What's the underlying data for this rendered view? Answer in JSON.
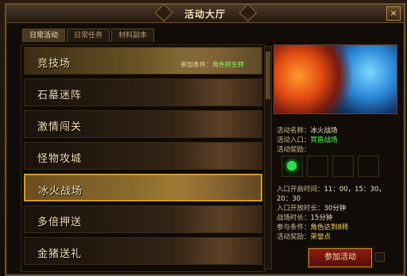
{
  "window": {
    "title": "活动大厅",
    "close_label": "×"
  },
  "tabs": [
    {
      "label": "日常活动",
      "active": true
    },
    {
      "label": "日常任务",
      "active": false
    },
    {
      "label": "材料副本",
      "active": false
    }
  ],
  "rows": [
    {
      "name": "竞技场",
      "time": "",
      "cond_label": "参加条件：",
      "cond_value": "角色转生转",
      "selected": false
    },
    {
      "name": "石墓迷阵",
      "time": "",
      "cond_label": "",
      "cond_value": "",
      "selected": false
    },
    {
      "name": "激情闯关",
      "time": "",
      "cond_label": "",
      "cond_value": "",
      "selected": false
    },
    {
      "name": "怪物攻城",
      "time": "",
      "cond_label": "",
      "cond_value": "",
      "selected": false
    },
    {
      "name": "冰火战场",
      "time": "",
      "cond_label": "",
      "cond_value": "",
      "selected": true
    },
    {
      "name": "多倍押送",
      "time": "",
      "cond_label": "",
      "cond_value": "",
      "selected": false
    },
    {
      "name": "金猪送礼",
      "time": "",
      "cond_label": "",
      "cond_value": "",
      "selected": false
    }
  ],
  "details": {
    "name_label": "活动名称：",
    "name_value": "冰火战场",
    "entry_label": "活动入口：",
    "entry_value": "冥盾战场",
    "reward_label": "活动奖励：",
    "open_time_label": "入口开启时间：",
    "open_time_value": "11：00，15：30，20：30",
    "open_duration_label": "入口开放时长：",
    "open_duration_value": "30分钟",
    "battle_duration_label": "战场时长：",
    "battle_duration_value": "15分钟",
    "condition_label": "参与条件：",
    "condition_value": "角色达到8转",
    "rewards_label": "活动奖励：",
    "rewards_value": "荣誉点"
  },
  "button": {
    "label": "参加活动"
  },
  "icons": {
    "close": "close-icon",
    "reward": "gem-icon"
  }
}
